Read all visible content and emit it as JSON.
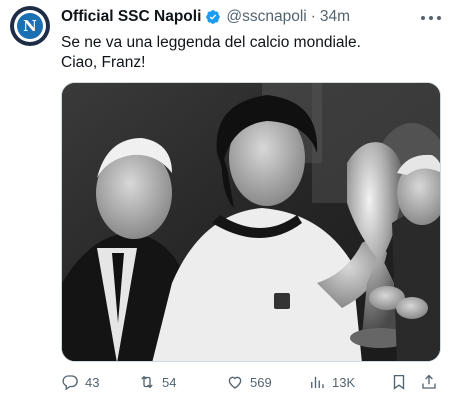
{
  "author": {
    "display_name": "Official SSC Napoli",
    "handle": "@sscnapoli",
    "separator": "·",
    "time": "34m",
    "avatar_letter": "N",
    "verified": true
  },
  "tweet": {
    "line1": "Se ne va una leggenda del calcio mondiale.",
    "line2": "Ciao, Franz!"
  },
  "media": {
    "type": "black-and-white photo"
  },
  "actions": {
    "replies": "43",
    "reposts": "54",
    "likes": "569",
    "views": "13K"
  },
  "icons": {
    "reply": "reply-icon",
    "repost": "repost-icon",
    "like": "heart-icon",
    "views": "views-icon",
    "bookmark": "bookmark-icon",
    "share": "share-icon",
    "more": "more-icon",
    "verified": "verified-badge-icon"
  },
  "colors": {
    "text_primary": "#0f1419",
    "text_secondary": "#536471",
    "verified_blue": "#1d9bf0",
    "border": "#cfd9de",
    "avatar_navy": "#1d2d45",
    "avatar_blue": "#1b6fb3"
  }
}
